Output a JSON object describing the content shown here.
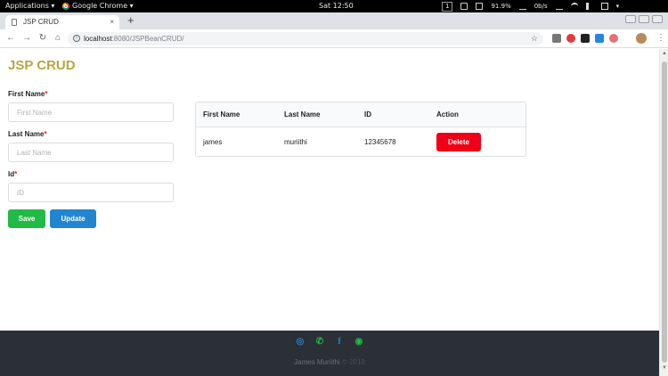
{
  "system_bar": {
    "applications": "Applications ▾",
    "active_app": "Google Chrome ▾",
    "clock": "Sat 12:50",
    "workspace": "1",
    "cpu": "91.9",
    "cpu_unit": "%",
    "net": "0b/s"
  },
  "browser": {
    "tab_title": "JSP CRUD",
    "tab_close": "×",
    "new_tab": "+",
    "url_host": "localhost",
    "url_path": ":8080/JSPBeanCRUD/"
  },
  "app": {
    "brand": "JSP CRUD",
    "form": {
      "first_name_label": "First Name",
      "first_name_placeholder": "First Name",
      "last_name_label": "Last Name",
      "last_name_placeholder": "Last Name",
      "id_label": "Id",
      "id_placeholder": "ID",
      "required_mark": "*",
      "save_label": "Save",
      "update_label": "Update"
    },
    "table": {
      "headers": [
        "First Name",
        "Last Name",
        "ID",
        "Action"
      ],
      "rows": [
        {
          "first_name": "james",
          "last_name": "muriithi",
          "id": "12345678",
          "action_label": "Delete"
        }
      ]
    }
  },
  "footer": {
    "author": "James Muriithi",
    "year": "© 2018",
    "icons": [
      "github-icon",
      "phone-icon",
      "facebook-icon",
      "whatsapp-icon"
    ],
    "icon_colors": [
      "#2185d0",
      "#21ba45",
      "#2185d0",
      "#21ba45"
    ]
  }
}
